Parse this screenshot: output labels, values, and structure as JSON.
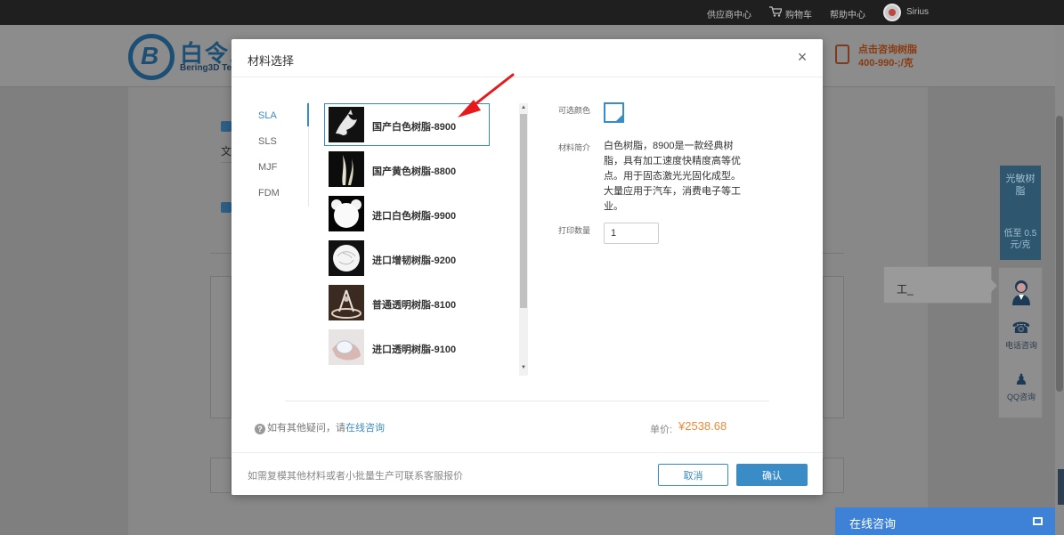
{
  "topbar": {
    "supplier_center": "供应商中心",
    "cart": "购物车",
    "help_center": "帮助中心",
    "username": "Sirius"
  },
  "header": {
    "logo_mark": "B",
    "logo_text": "白令三",
    "logo_sub": "Bering3D Tec",
    "consult_line1": "点击咨询树脂",
    "consult_line2": "400-990-;/克"
  },
  "background": {
    "wen_char": "文"
  },
  "side_ad": {
    "text": "光敏树脂",
    "price": "低至 0.5元/克"
  },
  "chat_bubble": {
    "text": "工_"
  },
  "side_tools": {
    "phone_label": "电话咨询",
    "qq_label": "QQ咨询"
  },
  "online_chat": {
    "label": "在线咨询"
  },
  "modal": {
    "title": "材料选择",
    "close": "×",
    "categories": [
      {
        "label": "SLA",
        "active": true
      },
      {
        "label": "SLS",
        "active": false
      },
      {
        "label": "MJF",
        "active": false
      },
      {
        "label": "FDM",
        "active": false
      }
    ],
    "materials": [
      {
        "name": "国产白色树脂-8900",
        "selected": true
      },
      {
        "name": "国产黄色树脂-8800",
        "selected": false
      },
      {
        "name": "进口白色树脂-9900",
        "selected": false
      },
      {
        "name": "进口增韧树脂-9200",
        "selected": false
      },
      {
        "name": "普通透明树脂-8100",
        "selected": false
      },
      {
        "name": "进口透明树脂-9100",
        "selected": false
      }
    ],
    "detail": {
      "color_label": "可选颜色",
      "desc_label": "材料简介",
      "description": "白色树脂，8900是一款经典树脂，具有加工速度快精度高等优点。用于固态激光光固化成型。大量应用于汽车，消费电子等工业。",
      "qty_label": "打印数量",
      "qty_value": "1"
    },
    "help_prefix": "如有其他疑问，请",
    "help_link": "在线咨询",
    "price_label": "单价:",
    "price_value": "¥2538.68",
    "footer_note": "如需复模其他材料或者小批量生产可联系客服报价",
    "cancel": "取消",
    "confirm": "确认"
  },
  "colors": {
    "accent": "#3a8cc7",
    "price": "#f08a37",
    "arrow": "#e8191b",
    "online_bar": "#3d82d6"
  }
}
